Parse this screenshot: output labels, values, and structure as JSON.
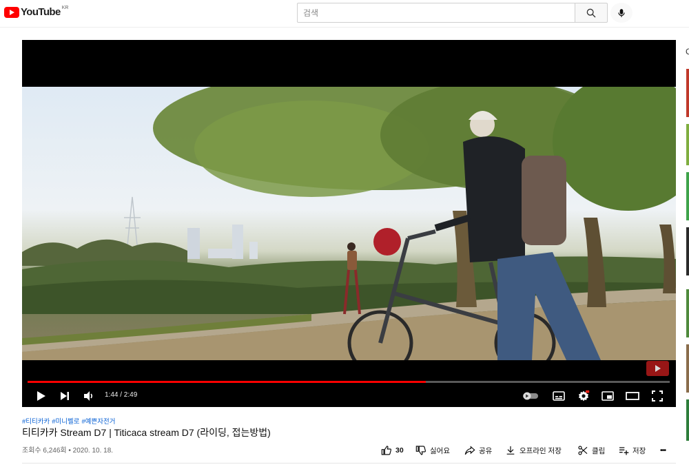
{
  "masthead": {
    "logo_text": "YouTube",
    "country_code": "KR",
    "search_placeholder": "검색"
  },
  "player": {
    "time_display": "1:44 / 2:49",
    "progress_fraction": 0.62
  },
  "video": {
    "hashtags": [
      "#티티카카",
      "#미니벨로",
      "#예쁜자전거"
    ],
    "title": "티티카카 Stream D7 | Titicaca stream D7 (라이딩, 접는방법)",
    "meta": "조회수 6,246회 • 2020. 10. 18."
  },
  "actions": {
    "like_count": "30",
    "dislike_label": "싫어요",
    "share_label": "공유",
    "offline_label": "오프라인 저장",
    "clip_label": "클립",
    "save_label": "저장",
    "more_label": "•••"
  },
  "sidebar": {
    "partial_letter": "C"
  },
  "colors": {
    "brand_red": "#ff0000",
    "link_blue": "#065fd4",
    "meta_gray": "#606060"
  }
}
